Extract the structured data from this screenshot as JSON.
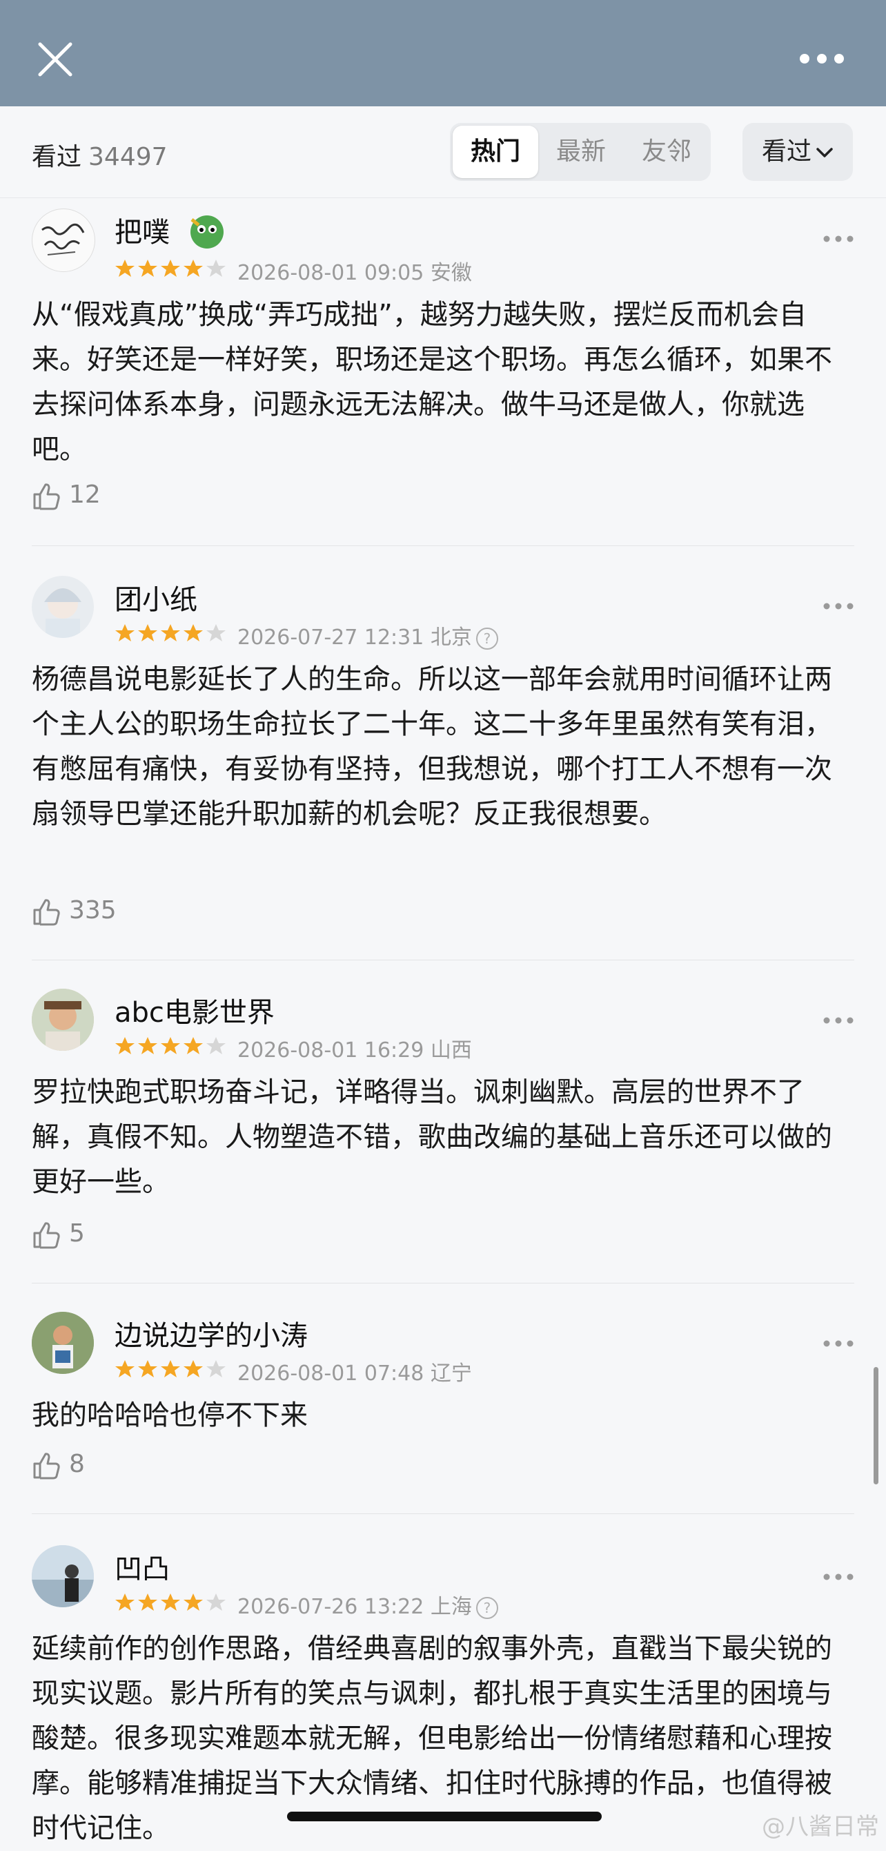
{
  "topbar": {
    "title_blur": "",
    "close_icon": "close-icon",
    "more_icon": "more-icon"
  },
  "subbar": {
    "seen_label": "看过",
    "seen_count": "34497",
    "tabs": [
      "热门",
      "最新",
      "友邻"
    ],
    "filter_label": "看过"
  },
  "reviews": [
    {
      "name": "把噗",
      "rating": 4,
      "date": "2026-08-01 09:05",
      "location": "安徽",
      "question_icon": false,
      "content": "从“假戏真成”换成“弄巧成拙”，越努力越失败，摆烂反而机会自来。好笑还是一样好笑，职场还是这个职场。再怎么循环，如果不去探问体系本身，问题永远无法解决。做牛马还是做人，你就选吧。",
      "likes": "12"
    },
    {
      "name": "团小纸",
      "rating": 4,
      "date": "2026-07-27 12:31",
      "location": "北京",
      "question_icon": true,
      "content": "杨德昌说电影延长了人的生命。所以这一部年会就用时间循环让两个主人公的职场生命拉长了二十年。这二十多年里虽然有笑有泪，有憋屈有痛快，有妥协有坚持，但我想说，哪个打工人不想有一次扇领导巴掌还能升职加薪的机会呢？反正我很想要。",
      "likes": "335"
    },
    {
      "name": "abc电影世界",
      "rating": 4,
      "date": "2026-08-01 16:29",
      "location": "山西",
      "question_icon": false,
      "content": "罗拉快跑式职场奋斗记，详略得当。讽刺幽默。高层的世界不了解，真假不知。人物塑造不错，歌曲改编的基础上音乐还可以做的更好一些。",
      "likes": "5"
    },
    {
      "name": "边说边学的小涛",
      "rating": 4,
      "date": "2026-08-01 07:48",
      "location": "辽宁",
      "question_icon": false,
      "content": "我的哈哈哈也停不下来",
      "likes": "8"
    },
    {
      "name": "凹凸",
      "rating": 4,
      "date": "2026-07-26 13:22",
      "location": "上海",
      "question_icon": true,
      "content": "延续前作的创作思路，借经典喜剧的叙事外壳，直戳当下最尖锐的现实议题。影片所有的笑点与讽刺，都扎根于真实生活里的困境与酸楚。很多现实难题本就无解，但电影给出一份情绪慰藉和心理按摩。能够精准捕捉当下大众情绪、扣住时代脉搏的作品，也值得被时代记住。",
      "likes": ""
    }
  ],
  "watermark": "@八酱日常",
  "colors": {
    "star": "#f5a623",
    "star_off": "#d6d6d6",
    "header": "#7e93a6"
  }
}
